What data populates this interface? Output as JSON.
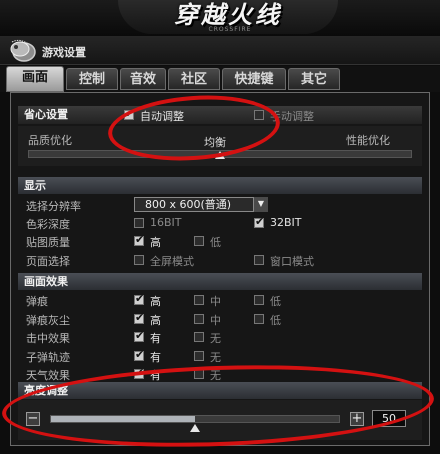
{
  "header": {
    "logo_text": "穿越火线",
    "logo_sub": "CROSSFIRE",
    "window_title": "游戏设置"
  },
  "tabs": [
    {
      "label": "画面",
      "active": true
    },
    {
      "label": "控制",
      "active": false
    },
    {
      "label": "音效",
      "active": false
    },
    {
      "label": "社区",
      "active": false
    },
    {
      "label": "快捷键",
      "active": false
    },
    {
      "label": "其它",
      "active": false
    }
  ],
  "quick": {
    "title": "省心设置",
    "auto_label": "自动调整",
    "auto_checked": true,
    "manual_label": "手动调整",
    "manual_checked": false,
    "quality_left": "品质优化",
    "quality_center": "均衡",
    "quality_right": "性能优化",
    "quality_level": 0.5
  },
  "display": {
    "title": "显示",
    "resolution_label": "选择分辨率",
    "resolution_value": "800 x 600(普通)",
    "color_label": "色彩深度",
    "color_16": "16BIT",
    "color_16_checked": false,
    "color_32": "32BIT",
    "color_32_checked": true,
    "texture_label": "贴图质量",
    "texture_high": "高",
    "texture_high_checked": true,
    "texture_low": "低",
    "texture_low_checked": false,
    "page_label": "页面选择",
    "fullscreen": "全屏模式",
    "fullscreen_checked": false,
    "window": "窗口模式",
    "window_checked": false
  },
  "effects": {
    "title": "画面效果",
    "rows": [
      {
        "label": "弹痕",
        "opts": [
          "高",
          "中",
          "低"
        ],
        "checked": [
          true,
          false,
          false
        ]
      },
      {
        "label": "弹痕灰尘",
        "opts": [
          "高",
          "中",
          "低"
        ],
        "checked": [
          true,
          false,
          false
        ]
      },
      {
        "label": "击中效果",
        "opts": [
          "有",
          "无"
        ],
        "checked": [
          true,
          false
        ]
      },
      {
        "label": "子弹轨迹",
        "opts": [
          "有",
          "无"
        ],
        "checked": [
          true,
          false
        ]
      },
      {
        "label": "天气效果",
        "opts": [
          "有",
          "无"
        ],
        "checked": [
          true,
          false
        ]
      }
    ]
  },
  "brightness": {
    "title": "亮度调整",
    "minus": "−",
    "plus": "+",
    "value": "50",
    "level": 0.5
  }
}
